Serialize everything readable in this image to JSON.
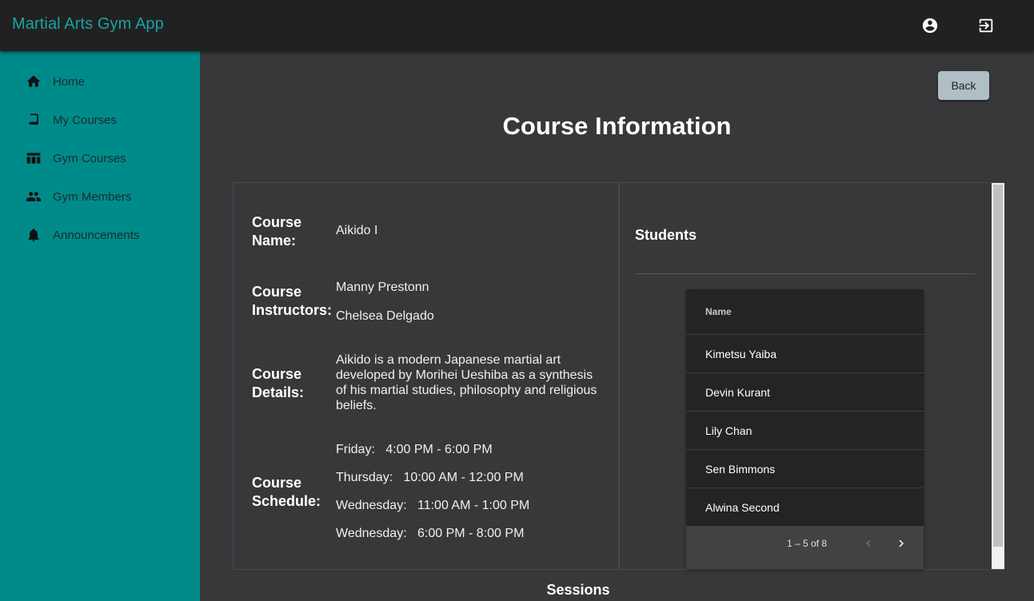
{
  "app": {
    "title": "Martial Arts Gym App"
  },
  "topbar": {
    "account_icon": "account-circle-icon",
    "logout_icon": "exit-to-app-icon"
  },
  "sidebar": {
    "items": [
      {
        "label": "Home",
        "icon": "home-icon"
      },
      {
        "label": "My Courses",
        "icon": "book-icon"
      },
      {
        "label": "Gym Courses",
        "icon": "table-icon"
      },
      {
        "label": "Gym Members",
        "icon": "people-icon"
      },
      {
        "label": "Announcements",
        "icon": "bell-icon"
      }
    ]
  },
  "page": {
    "title": "Course Information",
    "back_label": "Back",
    "sessions_title": "Sessions"
  },
  "course": {
    "name_label": "Course Name:",
    "name": "Aikido I",
    "instructors_label": "Course Instructors:",
    "instructors": [
      "Manny Prestonn",
      "Chelsea Delgado"
    ],
    "details_label": "Course Details:",
    "details": "Aikido is a modern Japanese martial art developed by Morihei Ueshiba as a synthesis of his martial studies, philosophy and religious beliefs.",
    "schedule_label": "Course Schedule:",
    "schedule": [
      {
        "day": "Friday:",
        "time": "4:00 PM - 6:00 PM"
      },
      {
        "day": "Thursday:",
        "time": "10:00 AM - 12:00 PM"
      },
      {
        "day": "Wednesday:",
        "time": "11:00 AM - 1:00 PM"
      },
      {
        "day": "Wednesday:",
        "time": "6:00 PM - 8:00 PM"
      }
    ]
  },
  "students": {
    "title": "Students",
    "column_header": "Name",
    "rows": [
      "Kimetsu Yaiba",
      "Devin Kurant",
      "Lily Chan",
      "Sen Bimmons",
      "Alwina Second"
    ],
    "range_label": "1 – 5 of 8"
  },
  "colors": {
    "accent": "#008b8b",
    "title_teal": "#1aa3a3",
    "background": "#38373a",
    "topbar": "#212121"
  }
}
